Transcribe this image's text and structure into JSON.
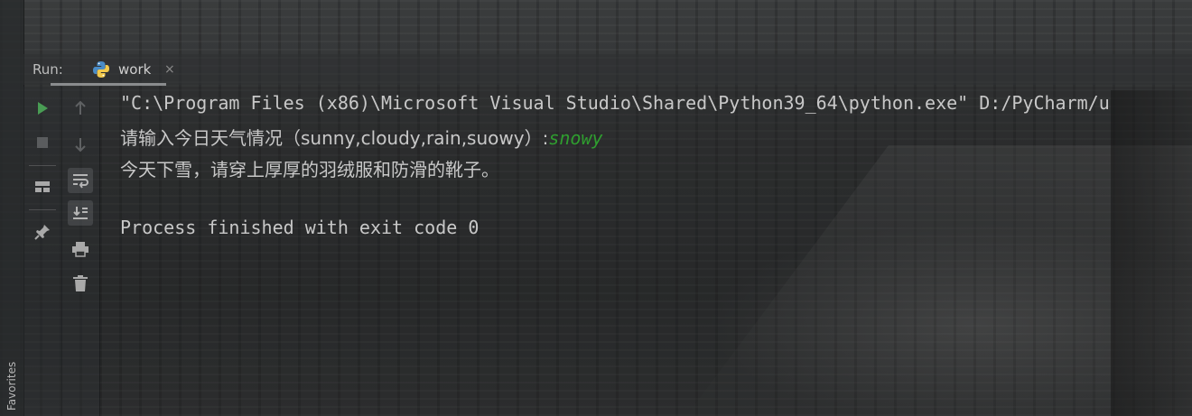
{
  "run_panel": {
    "label": "Run:",
    "tab_label": "work",
    "tab_close": "×"
  },
  "sidebar": {
    "favorites_label": "Favorites"
  },
  "toolbar_left": [
    {
      "icon": "run-icon"
    },
    {
      "icon": "stop-icon"
    },
    {
      "icon": "layout-icon"
    },
    {
      "icon": "pin-icon"
    }
  ],
  "toolbar_right": [
    {
      "icon": "arrow-up-icon"
    },
    {
      "icon": "arrow-down-icon"
    },
    {
      "icon": "soft-wrap-icon"
    },
    {
      "icon": "scroll-to-end-icon"
    },
    {
      "icon": "print-icon"
    },
    {
      "icon": "trash-icon"
    }
  ],
  "console": {
    "command_line": "\"C:\\Program Files (x86)\\Microsoft Visual Studio\\Shared\\Python39_64\\python.exe\" D:/PyCharm/u",
    "prompt_text": "请输入今日天气情况（sunny,cloudy,rain,suowy）:",
    "user_input": "snowy",
    "output_line": "今天下雪，请穿上厚厚的羽绒服和防滑的靴子。",
    "exit_message": "Process finished with exit code 0"
  },
  "colors": {
    "run_green": "#499c54",
    "input_green": "#2f9e2f",
    "text": "#c8c8c8"
  }
}
